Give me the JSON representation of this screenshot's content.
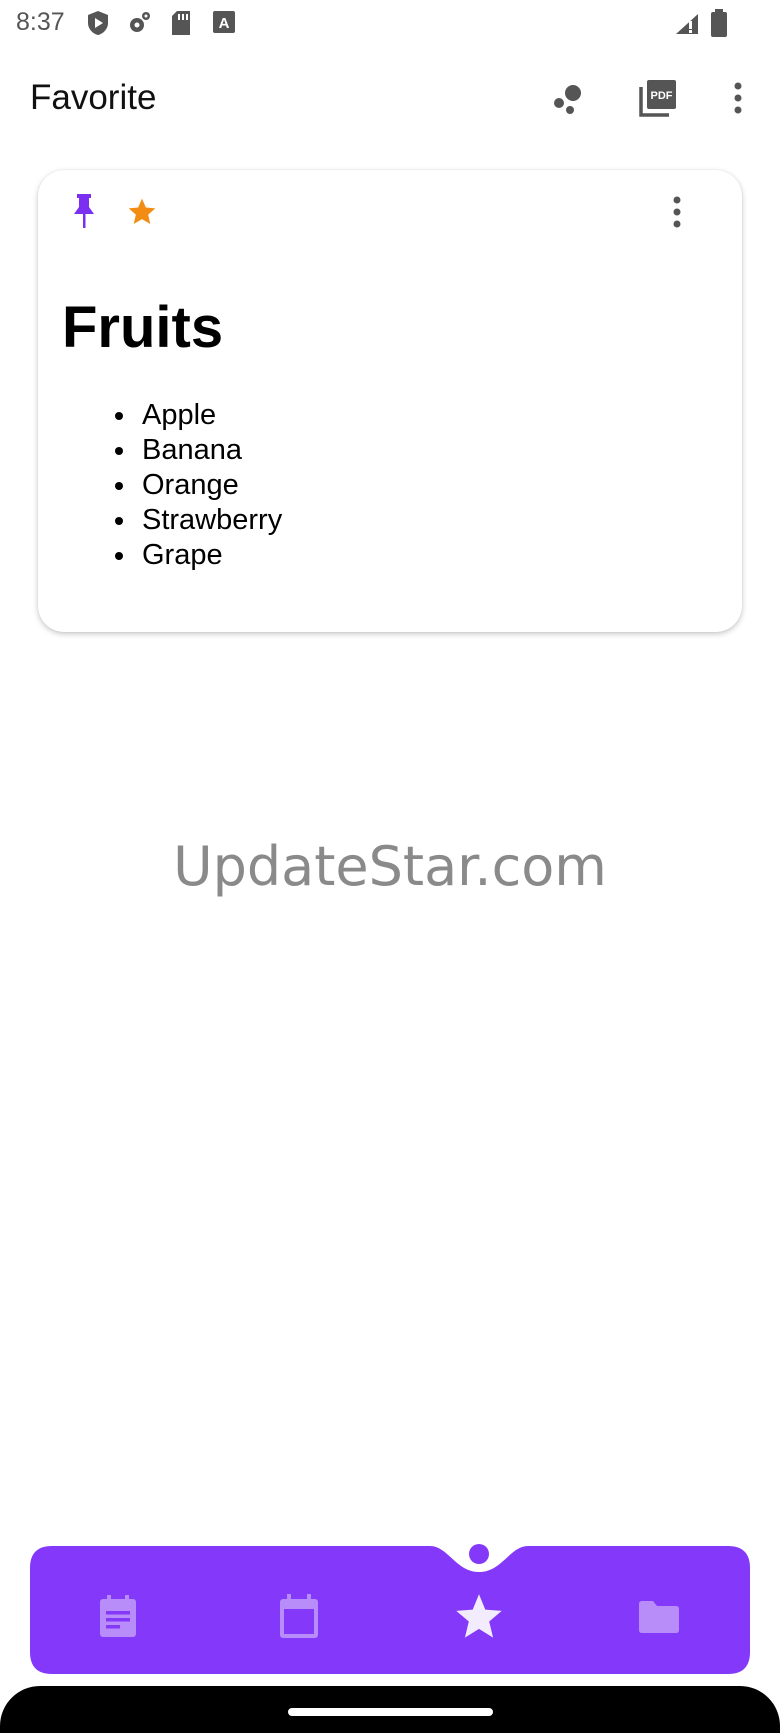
{
  "status_bar": {
    "time": "8:37",
    "left_icons": [
      "shield-play-icon",
      "settings-gear-icon",
      "sd-card-icon",
      "font-a-icon"
    ],
    "right_icons": [
      "signal-icon",
      "battery-icon"
    ]
  },
  "app_bar": {
    "title": "Favorite",
    "actions": [
      "bubbles-icon",
      "pdf-icon",
      "more-vert-icon"
    ]
  },
  "note": {
    "pinned": true,
    "favorite": true,
    "title": "Fruits",
    "items": [
      "Apple",
      "Banana",
      "Orange",
      "Strawberry",
      "Grape"
    ]
  },
  "watermark": "UpdateStar.com",
  "bottom_nav": {
    "items": [
      {
        "icon": "notes-icon",
        "active": false
      },
      {
        "icon": "calendar-icon",
        "active": false
      },
      {
        "icon": "star-icon",
        "active": true
      },
      {
        "icon": "folder-icon",
        "active": false
      }
    ]
  },
  "colors": {
    "accent": "#8438fa",
    "pin": "#7b2ff0",
    "star": "#f28c12",
    "icon_grey": "#555555"
  }
}
